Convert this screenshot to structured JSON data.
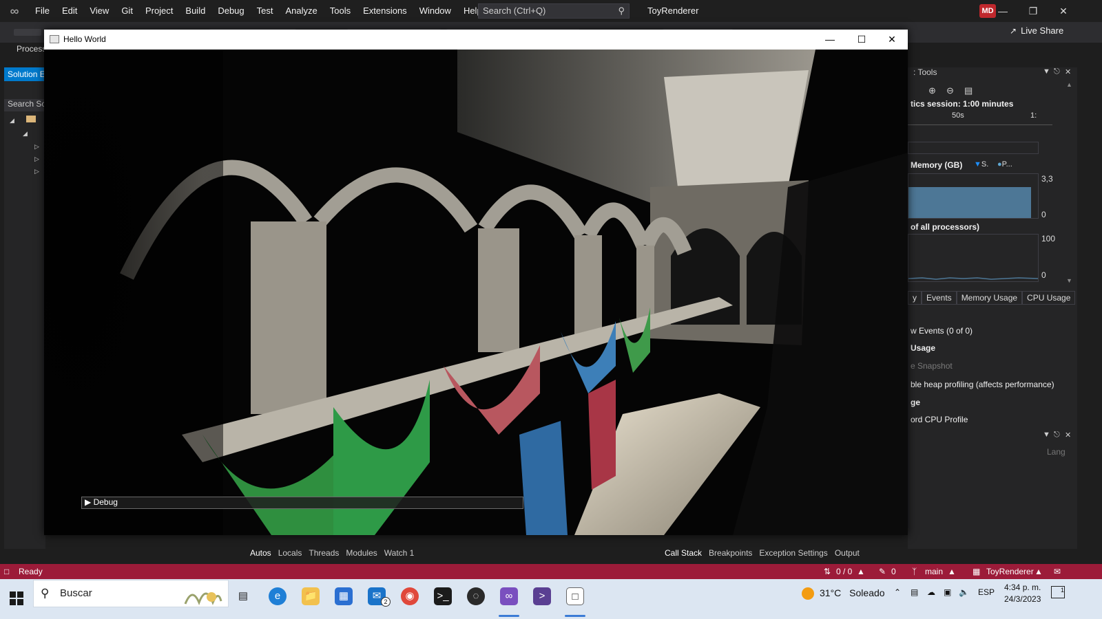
{
  "vs": {
    "menu": [
      "File",
      "Edit",
      "View",
      "Git",
      "Project",
      "Build",
      "Debug",
      "Test",
      "Analyze",
      "Tools",
      "Extensions",
      "Window",
      "Help"
    ],
    "search_label": "Search (Ctrl+Q)",
    "app_name": "ToyRenderer",
    "avatar_initials": "MD",
    "live_share": "Live Share",
    "process_label": "Process"
  },
  "solution_explorer": {
    "tab_label": "Solution E",
    "search_label": "Search Sol"
  },
  "diagnostic_tools": {
    "title": ": Tools",
    "session": "tics session: 1:00 minutes",
    "ruler_labels": [
      "50s",
      "1:"
    ],
    "memory_title": "Memory (GB)",
    "legend_s": "S.",
    "legend_p": "P...",
    "memory_max": "3,3",
    "memory_min": "0",
    "cpu_title": "of all processors)",
    "cpu_max": "100",
    "cpu_min": "0",
    "tabs": [
      "y",
      "Events",
      "Memory Usage",
      "CPU Usage"
    ],
    "lines": [
      "w Events (0 of 0)",
      "Usage",
      "e Snapshot",
      "ble heap profiling (affects performance)",
      "ge",
      "ord CPU Profile"
    ],
    "lang": "Lang"
  },
  "hello_world": {
    "title": "Hello World",
    "debug_label": "Debug"
  },
  "debug_tabs_left": [
    "Autos",
    "Locals",
    "Threads",
    "Modules",
    "Watch 1"
  ],
  "debug_tabs_right": [
    "Call Stack",
    "Breakpoints",
    "Exception Settings",
    "Output"
  ],
  "status": {
    "ready": "Ready",
    "changes": "0 / 0",
    "edits": "0",
    "branch": "main",
    "repo": "ToyRenderer"
  },
  "taskbar": {
    "search": "Buscar",
    "temp": "31°C",
    "weather": "Soleado",
    "lang": "ESP",
    "time": "4:34 p. m.",
    "date": "24/3/2023",
    "mail_badge": "2",
    "notif_count": "1"
  },
  "colors": {
    "status_bar": "#9c1b39",
    "accent": "#007acc",
    "memory_fill": "#4d7796"
  }
}
